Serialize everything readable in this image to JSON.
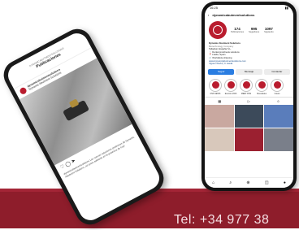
{
  "footer": {
    "tel": "Tel: +34 977 38"
  },
  "phone_left": {
    "title": "Publicaciones",
    "subtitle": "DYNAMICABUTMENTSOLUTIONS",
    "username": "dynamicabutmentsolutions",
    "location": "Dynamic Abutment Solutions",
    "caption": "dynamicabutmentsolutions Las nuevas soluciones protésicas de Dynamic Abutment Solutions, ¡un paso adelante en la protésica de hoy!"
  },
  "phone_right": {
    "status_time": "16:25",
    "username": "dynamicabutmentsolutions",
    "stats": [
      {
        "n": "174",
        "l": "Publicaciones"
      },
      {
        "n": "995",
        "l": "Seguidores"
      },
      {
        "n": "1097",
        "l": "Siguiendo"
      }
    ],
    "bio_name": "Dynamic Abutment Solutions",
    "bio_cat": "Biotechnology Company",
    "bio_lines": [
      "Talladium España S.L.",
      "🦷 Dental prosthesis solutions",
      "📍 Lleida, Spain",
      "🛒 Worldwide shipping",
      "www.dynamicabutmentsolutions.com",
      "Vigone World | C Lleida"
    ],
    "buttons": [
      "Seguir",
      "Mensaje",
      "Contactar"
    ],
    "highlights": [
      "DSS NEWS",
      "Eventos 2023",
      "MEET DSS",
      "Novedades",
      "Casos"
    ]
  },
  "colors": {
    "brand": "#8e1d2b",
    "accent": "#b91c2e"
  }
}
